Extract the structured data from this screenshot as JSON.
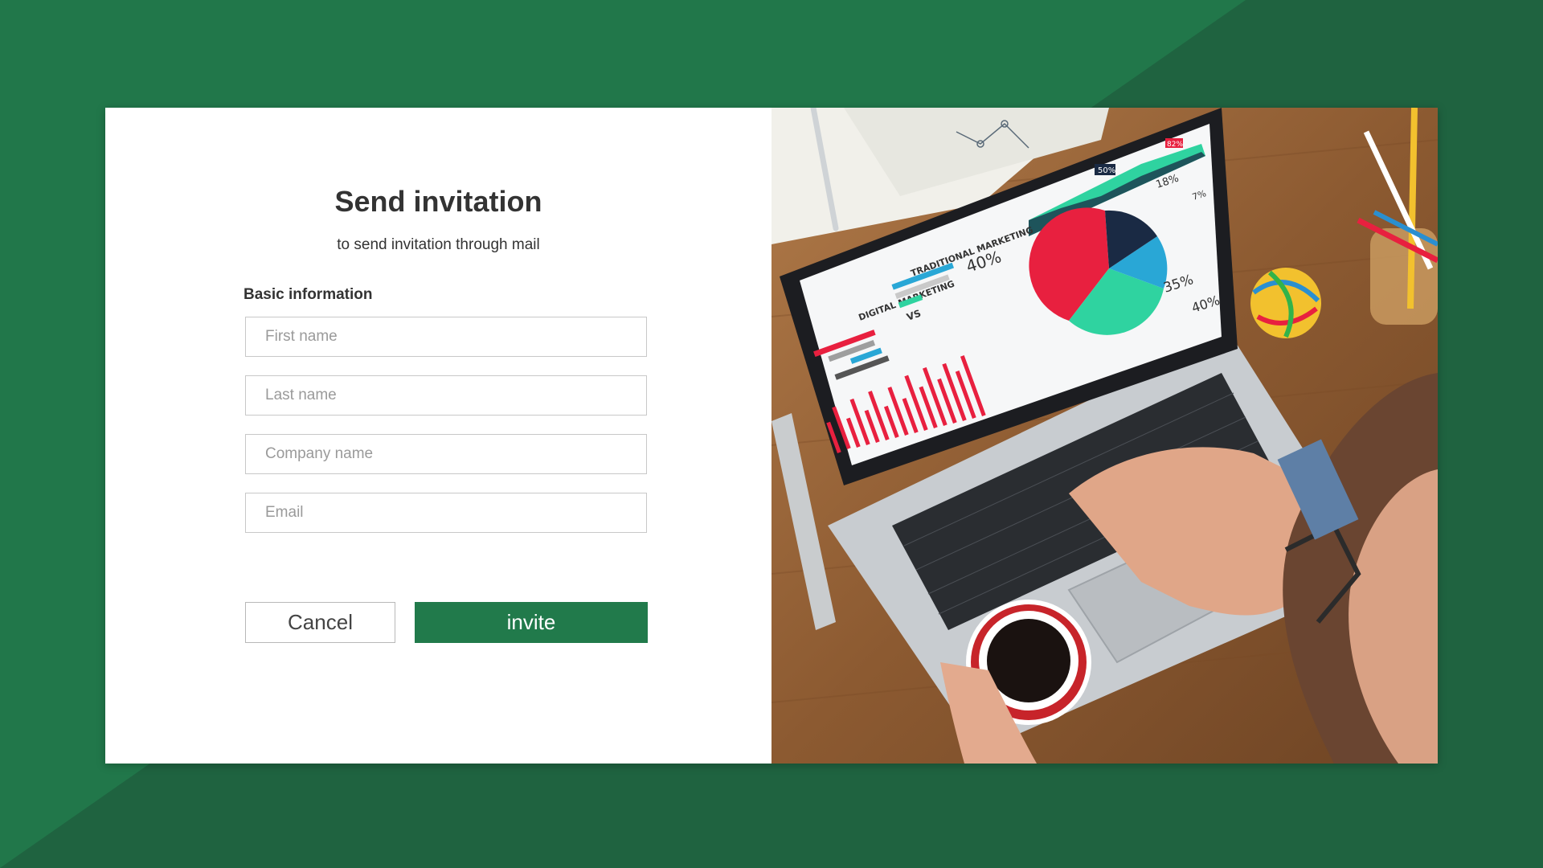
{
  "colors": {
    "background": "#21774a",
    "background_shade": "#1f6340",
    "accent": "#217a4b",
    "text": "#333333"
  },
  "dialog": {
    "title": "Send invitation",
    "subtitle": "to send invitation through mail",
    "section_label": "Basic information",
    "fields": {
      "first_name": {
        "placeholder": "First name",
        "value": ""
      },
      "last_name": {
        "placeholder": "Last name",
        "value": ""
      },
      "company_name": {
        "placeholder": "Company name",
        "value": ""
      },
      "email": {
        "placeholder": "Email",
        "value": ""
      }
    },
    "buttons": {
      "cancel": "Cancel",
      "invite": "invite"
    }
  },
  "illustration": {
    "subject": "laptop-marketing-dashboard-photo",
    "screen_title_left": "DIGITAL MARKETING",
    "screen_vs": "VS",
    "screen_title_right": "TRADITIONAL MARKETING",
    "pie_labels": [
      "40%",
      "18%",
      "7%",
      "35%",
      "40%"
    ],
    "badge_labels": [
      "50%",
      "82%"
    ]
  }
}
